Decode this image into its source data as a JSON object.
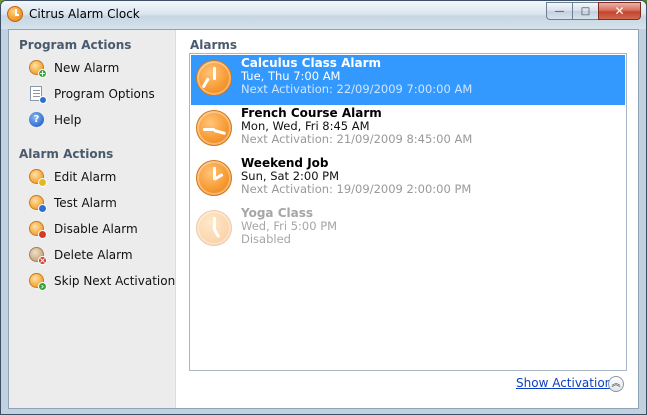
{
  "window": {
    "title": "Citrus Alarm Clock"
  },
  "titlebar": {
    "minimize": "—",
    "maximize": "□",
    "close": "✕"
  },
  "sidebar": {
    "program_actions_title": "Program Actions",
    "program_actions": [
      {
        "label": "New Alarm",
        "icon": "new-alarm-icon"
      },
      {
        "label": "Program Options",
        "icon": "options-document-icon"
      },
      {
        "label": "Help",
        "icon": "help-icon"
      }
    ],
    "alarm_actions_title": "Alarm Actions",
    "alarm_actions": [
      {
        "label": "Edit Alarm",
        "icon": "edit-alarm-icon"
      },
      {
        "label": "Test Alarm",
        "icon": "test-alarm-icon"
      },
      {
        "label": "Disable Alarm",
        "icon": "disable-alarm-icon"
      },
      {
        "label": "Delete Alarm",
        "icon": "delete-alarm-icon"
      },
      {
        "label": "Skip Next Activation",
        "icon": "skip-alarm-icon"
      }
    ]
  },
  "main": {
    "title": "Alarms",
    "alarms": [
      {
        "name": "Calculus Class Alarm",
        "schedule": "Tue, Thu 7:00 AM",
        "next": "Next Activation: 22/09/2009 7:00:00 AM",
        "selected": true,
        "enabled": true
      },
      {
        "name": "French Course Alarm",
        "schedule": "Mon, Wed, Fri 8:45 AM",
        "next": "Next Activation: 21/09/2009 8:45:00 AM",
        "selected": false,
        "enabled": true
      },
      {
        "name": "Weekend Job",
        "schedule": "Sun, Sat 2:00 PM",
        "next": "Next Activation: 19/09/2009 2:00:00 PM",
        "selected": false,
        "enabled": true
      },
      {
        "name": "Yoga Class",
        "schedule": "Wed, Fri 5:00 PM",
        "next": "Disabled",
        "selected": false,
        "enabled": false
      }
    ],
    "show_activations_label": "Show Activations",
    "collapse_glyph": "︽"
  },
  "colors": {
    "selection": "#3399ff",
    "section_title": "#4a5a6e",
    "link": "#0b3fc2"
  }
}
